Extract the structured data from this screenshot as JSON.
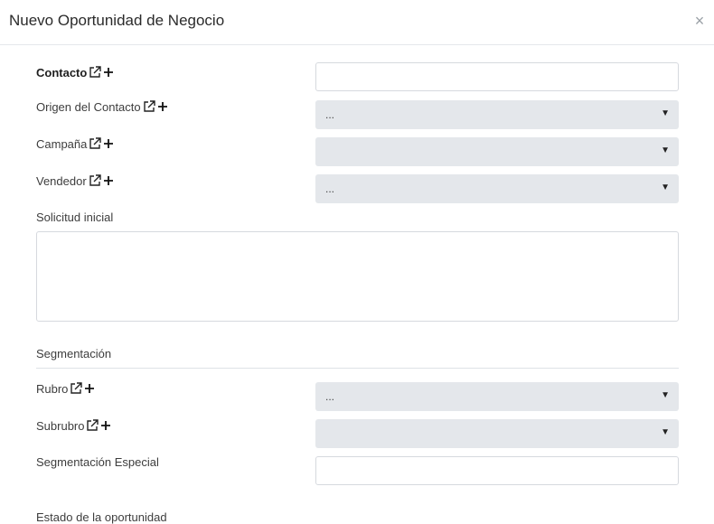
{
  "modal": {
    "title": "Nuevo Oportunidad de Negocio",
    "close_symbol": "×"
  },
  "fields": {
    "contacto": {
      "label": "Contacto",
      "value": ""
    },
    "origen": {
      "label": "Origen del Contacto",
      "value": "..."
    },
    "campana": {
      "label": "Campaña",
      "value": ""
    },
    "vendedor": {
      "label": "Vendedor",
      "value": "..."
    },
    "solicitud": {
      "label": "Solicitud inicial",
      "value": ""
    },
    "rubro": {
      "label": "Rubro",
      "value": "..."
    },
    "subrubro": {
      "label": "Subrubro",
      "value": ""
    },
    "segmentacion_especial": {
      "label": "Segmentación Especial",
      "value": ""
    }
  },
  "sections": {
    "segmentacion": "Segmentación",
    "estado": "Estado de la oportunidad"
  },
  "icons": {
    "open_link": "external-link-icon",
    "add": "plus-icon",
    "dropdown": "caret-down-icon"
  },
  "symbols": {
    "plus": "+",
    "caret": "▼"
  }
}
